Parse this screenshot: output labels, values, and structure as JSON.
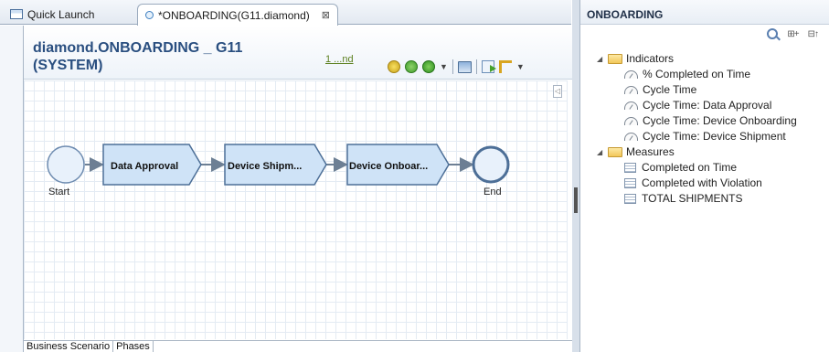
{
  "tabs": {
    "quick_launch": "Quick Launch",
    "editor": "*ONBOARDING(G11.diamond)",
    "close_glyph": "⊠"
  },
  "editor": {
    "title_line1": "diamond.ONBOARDING _ G11",
    "title_line2": "(SYSTEM)",
    "phase_link": "1 ...nd",
    "process": {
      "start": "Start",
      "end": "End",
      "steps": [
        "Data Approval",
        "Device Shipm...",
        "Device Onboar..."
      ]
    },
    "bottom_tabs": [
      "Business Scenario",
      "Phases"
    ]
  },
  "outline": {
    "title": "ONBOARDING",
    "indicators_label": "Indicators",
    "indicators": [
      "% Completed on Time",
      "Cycle Time",
      "Cycle Time: Data Approval",
      "Cycle Time: Device Onboarding",
      "Cycle Time: Device Shipment"
    ],
    "measures_label": "Measures",
    "measures": [
      "Completed on Time",
      "Completed with Violation",
      "TOTAL SHIPMENTS"
    ]
  },
  "colors": {
    "title": "#2a4f80",
    "shape_fill": "#cfe3f7",
    "shape_stroke": "#4d6f97",
    "link": "#5c7f1e"
  },
  "icons": {
    "quick_launch": "table-icon",
    "editor_tab": "process-shape-icon",
    "indicator": "gauge-icon",
    "measure": "measure-table-icon",
    "folder": "folder-icon"
  }
}
